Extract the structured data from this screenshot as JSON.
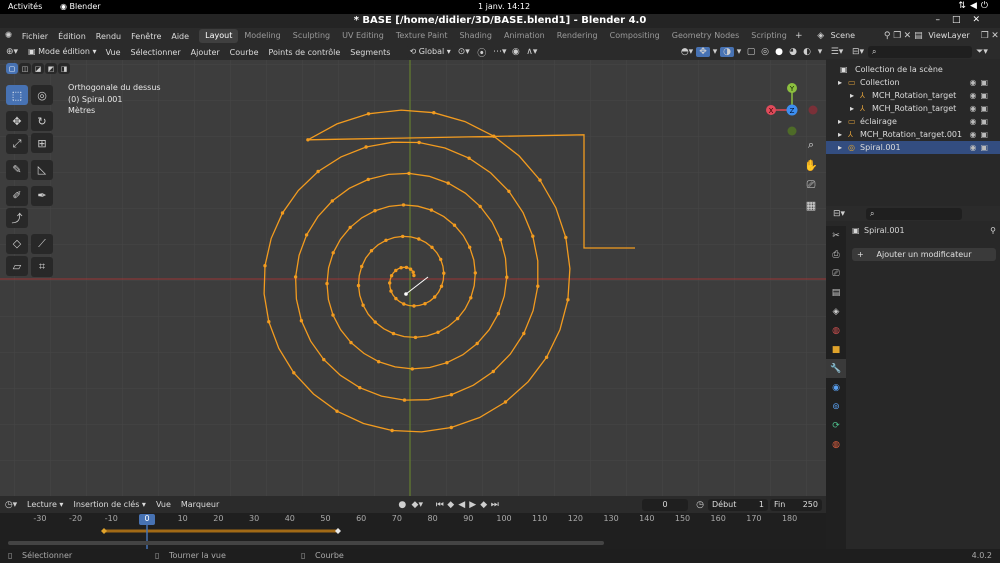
{
  "system": {
    "activities": "Activités",
    "app_name": "Blender",
    "clock": "1 janv.  14:12"
  },
  "window": {
    "title": "* BASE [/home/didier/3D/BASE.blend1] - Blender 4.0"
  },
  "menu": [
    "Fichier",
    "Édition",
    "Rendu",
    "Fenêtre",
    "Aide"
  ],
  "workspaces": [
    {
      "label": "Layout",
      "active": true
    },
    {
      "label": "Modeling"
    },
    {
      "label": "Sculpting"
    },
    {
      "label": "UV Editing"
    },
    {
      "label": "Texture Paint"
    },
    {
      "label": "Shading"
    },
    {
      "label": "Animation"
    },
    {
      "label": "Rendering"
    },
    {
      "label": "Compositing"
    },
    {
      "label": "Geometry Nodes"
    },
    {
      "label": "Scripting"
    }
  ],
  "scene": {
    "name": "Scene",
    "view_layer": "ViewLayer"
  },
  "viewport_header": {
    "mode": "Mode édition",
    "menus": [
      "Vue",
      "Sélectionner",
      "Ajouter",
      "Courbe",
      "Points de contrôle",
      "Segments"
    ],
    "orientation": "Global"
  },
  "viewport": {
    "overlay": {
      "view_name": "Orthogonale du dessus",
      "object_info": "(0) Spiral.001",
      "units": "Mètres"
    },
    "gizmo": {
      "x": "X",
      "y": "Y",
      "z": "Z"
    },
    "colors": {
      "background": "#3d3d3d",
      "curve": "#f29b1f",
      "x_axis": "#9c3535",
      "y_axis": "#6b8a2a"
    }
  },
  "timeline": {
    "menus": [
      "Lecture",
      "Insertion de clés",
      "Vue",
      "Marqueur"
    ],
    "current_frame": "0",
    "start_label": "Début",
    "start_value": "1",
    "end_label": "Fin",
    "end_value": "250",
    "ruler": [
      "-30",
      "-20",
      "-10",
      "0",
      "10",
      "20",
      "30",
      "40",
      "50",
      "60",
      "70",
      "80",
      "90",
      "100",
      "110",
      "120",
      "130",
      "140",
      "150",
      "160",
      "170",
      "180"
    ]
  },
  "status": {
    "select": "Sélectionner",
    "rotate": "Tourner la vue",
    "curve": "Courbe",
    "version": "4.0.2"
  },
  "outliner": {
    "root": "Collection de la scène",
    "rows": [
      {
        "label": "Collection",
        "indent": 1
      },
      {
        "label": "MCH_Rotation_target",
        "indent": 2
      },
      {
        "label": "MCH_Rotation_target",
        "indent": 2
      },
      {
        "label": "éclairage",
        "indent": 1
      },
      {
        "label": "MCH_Rotation_target.001",
        "indent": 1
      },
      {
        "label": "Spiral.001",
        "indent": 1,
        "selected": true
      }
    ]
  },
  "properties": {
    "object_name": "Spiral.001",
    "add_modifier": "Ajouter un modificateur"
  }
}
